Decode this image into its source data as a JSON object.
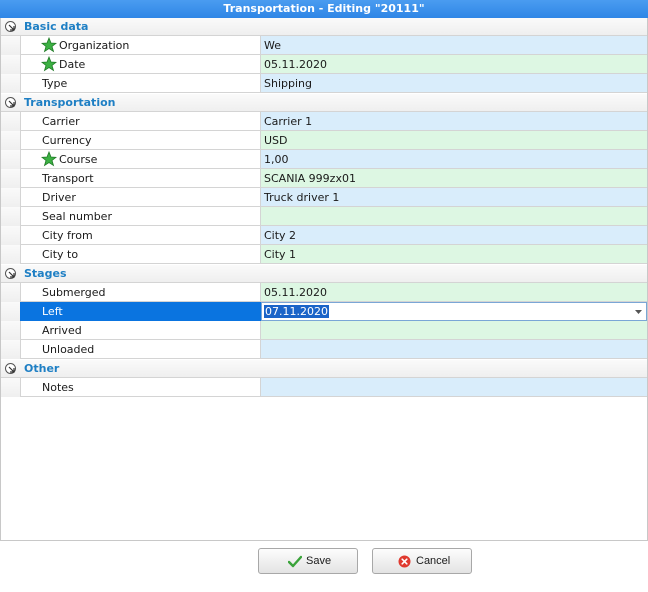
{
  "window": {
    "title": "Transportation - Editing \"20111\""
  },
  "colors": {
    "title_bar": "#2f86e6",
    "category_text": "#1e7fc4",
    "value_blue": "#d9edfb",
    "value_green": "#ddf7e3",
    "selection": "#0a74e0"
  },
  "sections": {
    "basic": {
      "label": "Basic data",
      "organization": {
        "name": "Organization",
        "value": "We"
      },
      "date": {
        "name": "Date",
        "value": "05.11.2020"
      },
      "type": {
        "name": "Type",
        "value": "Shipping"
      }
    },
    "transportation": {
      "label": "Transportation",
      "carrier": {
        "name": "Carrier",
        "value": "Carrier 1"
      },
      "currency": {
        "name": "Currency",
        "value": "USD"
      },
      "course": {
        "name": "Course",
        "value": "1,00"
      },
      "transport": {
        "name": "Transport",
        "value": "SCANIA 999zx01"
      },
      "driver": {
        "name": "Driver",
        "value": "Truck driver 1"
      },
      "seal": {
        "name": "Seal number",
        "value": ""
      },
      "city_from": {
        "name": "City from",
        "value": "City 2"
      },
      "city_to": {
        "name": "City to",
        "value": "City 1"
      }
    },
    "stages": {
      "label": "Stages",
      "submerged": {
        "name": "Submerged",
        "value": "05.11.2020"
      },
      "left": {
        "name": "Left",
        "value": "07.11.2020"
      },
      "arrived": {
        "name": "Arrived",
        "value": ""
      },
      "unloaded": {
        "name": "Unloaded",
        "value": ""
      }
    },
    "other": {
      "label": "Other",
      "notes": {
        "name": "Notes",
        "value": ""
      }
    }
  },
  "buttons": {
    "save": "Save",
    "cancel": "Cancel"
  },
  "icons": {
    "required": "green-star-icon",
    "collapse": "collapse-arrow-icon",
    "save": "checkmark-icon",
    "cancel": "cancel-circle-icon",
    "dropdown": "dropdown-arrow-icon"
  }
}
